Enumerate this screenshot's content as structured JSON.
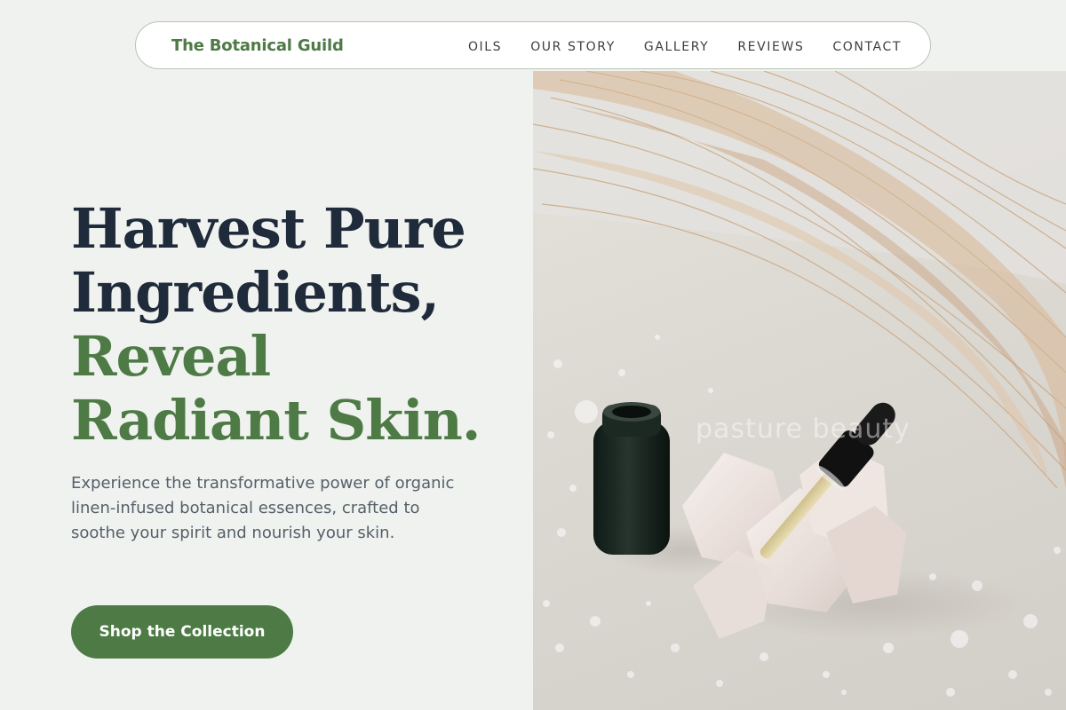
{
  "nav": {
    "brand": "The Botanical Guild",
    "links": [
      "OILS",
      "OUR STORY",
      "GALLERY",
      "REVIEWS",
      "CONTACT"
    ]
  },
  "hero": {
    "title_lines": [
      "Harvest Pure",
      "Ingredients,",
      "Reveal",
      "Radiant Skin."
    ],
    "subtitle": "Experience the transformative power of organic linen-infused botanical essences, crafted to soothe your spirit and nourish your skin.",
    "cta_label": "Shop the Collection",
    "image_watermark": "pasture beauty"
  },
  "colors": {
    "accent": "#4d7a45",
    "heading": "#1f2a3a",
    "background": "#f0f2ef"
  }
}
